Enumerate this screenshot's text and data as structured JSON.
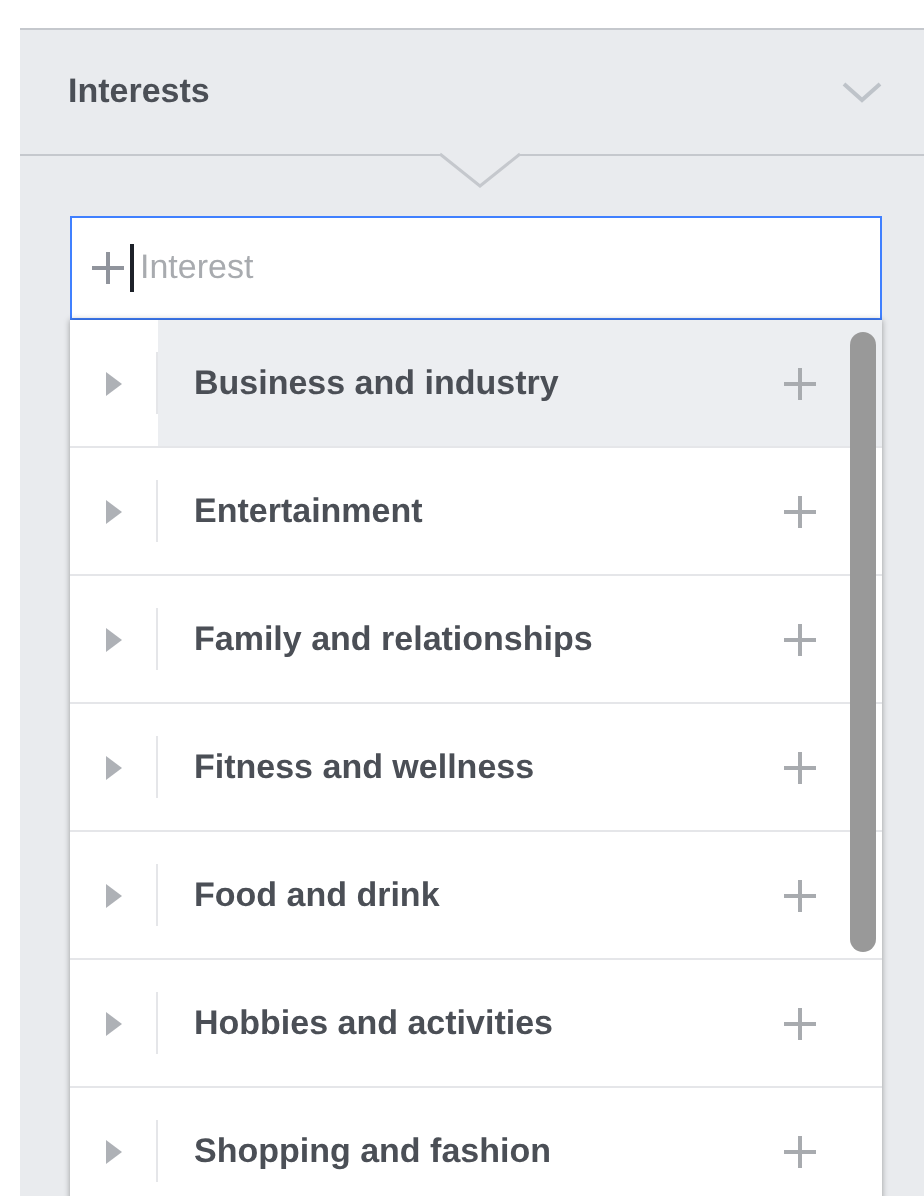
{
  "section": {
    "title": "Interests",
    "expanded": true
  },
  "search": {
    "placeholder": "Interest"
  },
  "items": [
    {
      "label": "Business and industry",
      "selected": true
    },
    {
      "label": "Entertainment",
      "selected": false
    },
    {
      "label": "Family and relationships",
      "selected": false
    },
    {
      "label": "Fitness and wellness",
      "selected": false
    },
    {
      "label": "Food and drink",
      "selected": false
    },
    {
      "label": "Hobbies and activities",
      "selected": false
    },
    {
      "label": "Shopping and fashion",
      "selected": false
    }
  ]
}
